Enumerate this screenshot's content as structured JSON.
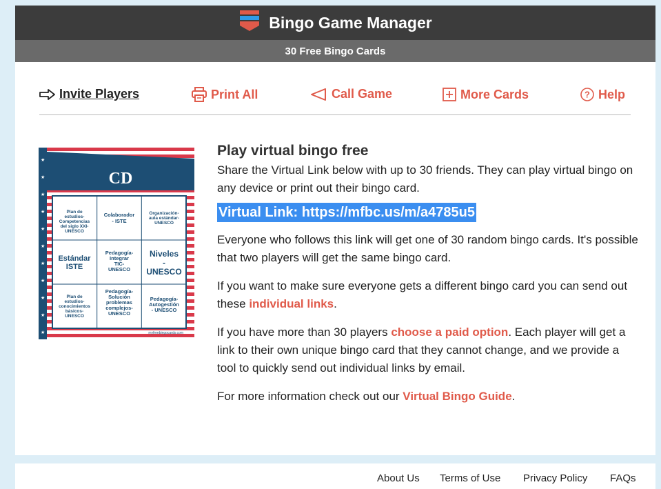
{
  "header": {
    "title": "Bingo Game Manager",
    "subtitle": "30 Free Bingo Cards"
  },
  "nav": {
    "invite": "Invite Players",
    "print": "Print All",
    "call": "Call Game",
    "more": "More Cards",
    "help": "Help"
  },
  "card": {
    "title": "CD",
    "cells": [
      "Plan de estudios-Competencias del siglo XXI-UNESCO",
      "Colaborador - ISTE",
      "Organización-aula estándar-UNESCO",
      "Estándar ISTE",
      "Pedagogía-Integrar TIC-UNESCO",
      "Niveles - UNESCO",
      "Plan de estudios-conocimientos básicos-UNESCO",
      "Pedagogía-Solución problemas complejos-UNESCO",
      "Pedagogía-Autogestión - UNESCO"
    ],
    "footer": "myfreebingocards.com"
  },
  "content": {
    "heading": "Play virtual bingo free",
    "intro": "Share the Virtual Link below with up to 30 friends. They can play virtual bingo on any device or print out their bingo card.",
    "virtual_link": "Virtual Link: https://mfbc.us/m/a4785u5",
    "p1": "Everyone who follows this link will get one of 30 random bingo cards. It's possible that two players will get the same bingo card.",
    "p2_pre": "If you want to make sure everyone gets a different bingo card you can send out these ",
    "p2_link": "individual links",
    "p2_post": ".",
    "p3_pre": "If you have more than 30 players ",
    "p3_link": "choose a paid option",
    "p3_post": ". Each player will get a link to their own unique bingo card that they cannot change, and we provide a tool to quickly send out individual links by email.",
    "p4_pre": "For more information check out our ",
    "p4_link": "Virtual Bingo Guide",
    "p4_post": "."
  },
  "footer": {
    "about": "About Us",
    "terms": "Terms of Use",
    "privacy": "Privacy Policy",
    "faqs": "FAQs"
  },
  "colors": {
    "accent": "#e05a4a",
    "link_highlight": "#3b8ef0",
    "header_bg": "#3c3c3c",
    "card_blue": "#1d4e74"
  },
  "icons": [
    "logo-icon",
    "arrow-right-icon",
    "printer-icon",
    "megaphone-icon",
    "plus-square-icon",
    "question-circle-icon"
  ]
}
